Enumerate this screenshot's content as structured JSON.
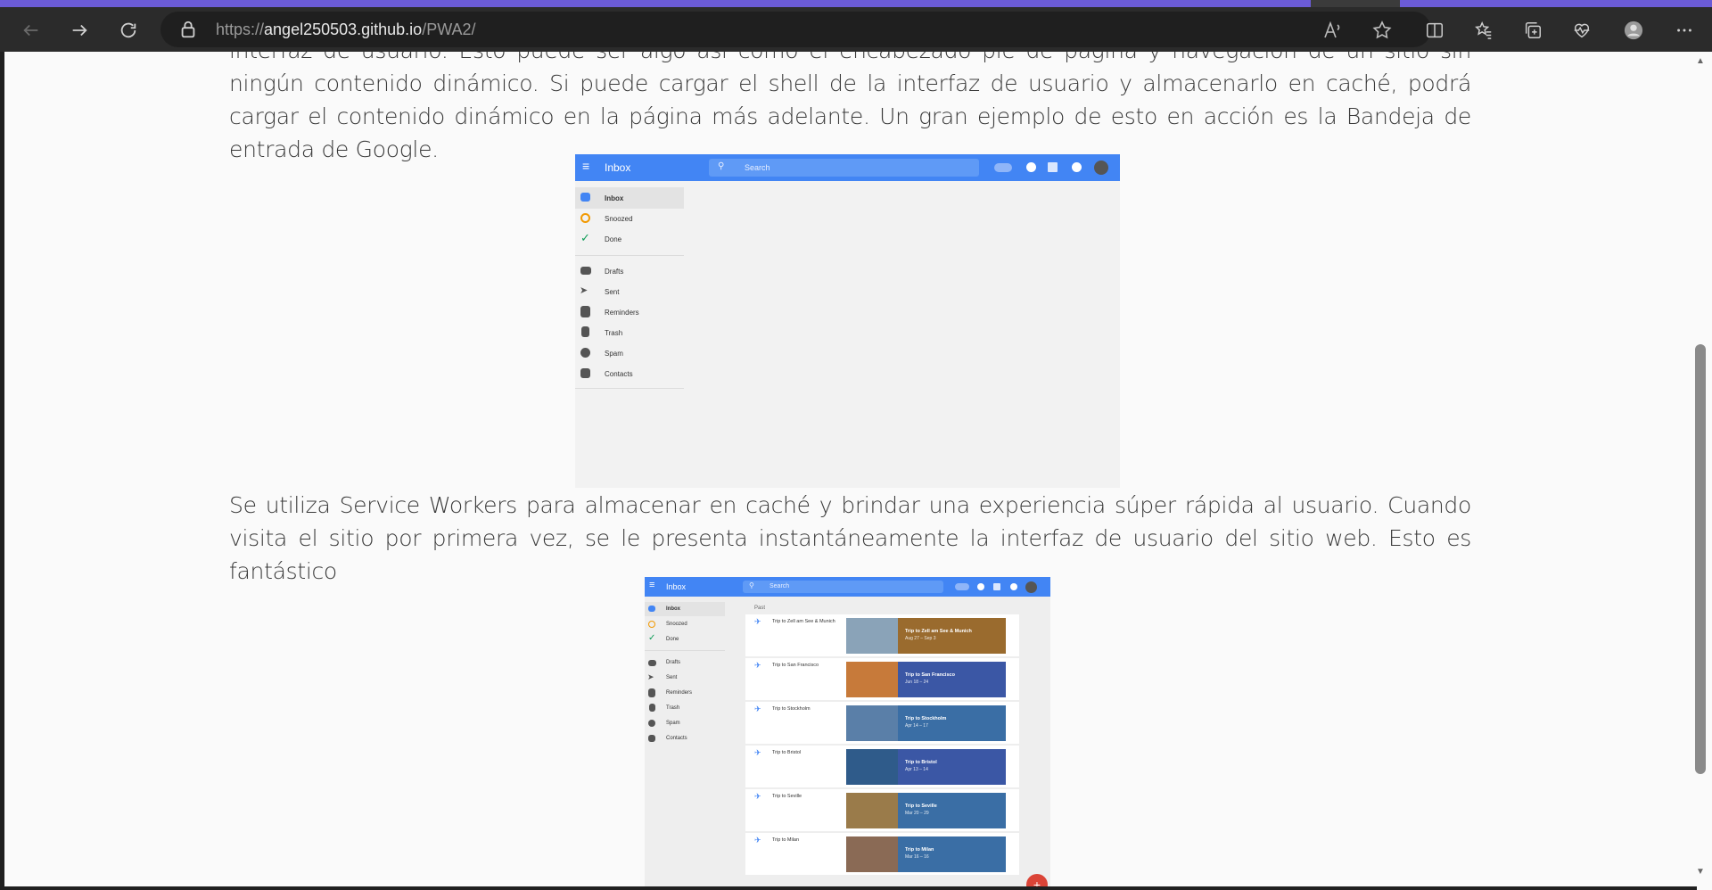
{
  "browser": {
    "url_prefix": "https://",
    "url_host": "angel250503.github.io",
    "url_path": "/PWA2/",
    "icons": [
      "back-arrow-icon",
      "forward-arrow-icon",
      "refresh-icon",
      "lock-icon",
      "read-aloud-icon",
      "star-icon",
      "split-screen-icon",
      "favorites-icon",
      "collections-icon",
      "health-icon",
      "profile-icon",
      "more-icon"
    ]
  },
  "article": {
    "paragraph1": "interfaz de usuario. Esto puede ser algo así como el encabezado pie de página y navegación de un sitio sin ningún contenido dinámico. Si puede cargar el shell de la interfaz de usuario y almacenarlo en caché, podrá cargar el contenido dinámico en la página más adelante. Un gran ejemplo de esto en acción es la Bandeja de entrada de Google.",
    "paragraph2": "Se utiliza Service Workers para almacenar en caché y brindar una experiencia súper rápida al usuario. Cuando visita el sitio por primera vez, se le presenta instantáneamente la interfaz de usuario del sitio web. Esto es fantástico"
  },
  "inbox_mock": {
    "app_title": "Inbox",
    "search_placeholder": "Search",
    "nav": [
      "Inbox",
      "Snoozed",
      "Done",
      "Drafts",
      "Sent",
      "Reminders",
      "Trash",
      "Spam",
      "Contacts"
    ],
    "section_label": "Past",
    "trips": [
      {
        "name": "Trip to Zell am See & Munich",
        "card_title": "Trip to Zell am See & Munich",
        "card_dates": "Aug 27 – Sep 3",
        "card_color": "#9a6b2e",
        "photo_color": "#8aa3b8"
      },
      {
        "name": "Trip to San Francisco",
        "card_title": "Trip to San Francisco",
        "card_dates": "Jun 18 – 24",
        "card_color": "#3b57a5",
        "photo_color": "#c77a3a"
      },
      {
        "name": "Trip to Stockholm",
        "card_title": "Trip to Stockholm",
        "card_dates": "Apr 14 – 17",
        "card_color": "#3a6ea5",
        "photo_color": "#5a7fa8"
      },
      {
        "name": "Trip to Bristol",
        "card_title": "Trip to Bristol",
        "card_dates": "Apr 13 – 14",
        "card_color": "#3b57a5",
        "photo_color": "#2f5b8a"
      },
      {
        "name": "Trip to Seville",
        "card_title": "Trip to Seville",
        "card_dates": "Mar 20 – 29",
        "card_color": "#3a6ea5",
        "photo_color": "#9a7b4a"
      },
      {
        "name": "Trip to Milan",
        "card_title": "Trip to Milan",
        "card_dates": "Mar 16 – 16",
        "card_color": "#3a6ea5",
        "photo_color": "#8a6a55"
      }
    ],
    "accent_color": "#4285f4",
    "fab_label": "+"
  }
}
